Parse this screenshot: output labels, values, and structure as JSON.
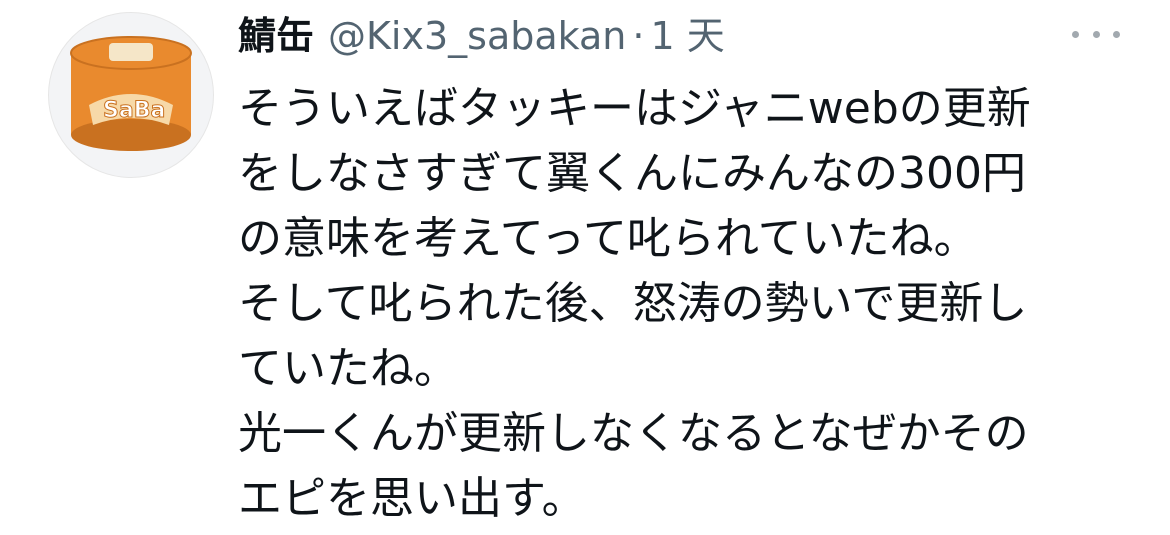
{
  "tweet": {
    "display_name": "鯖缶",
    "handle": "@Kix3_sabakan",
    "separator": "·",
    "timestamp": "1 天",
    "avatar_icon": "saba-can-icon",
    "avatar_text": "SaBa",
    "lines": [
      "そういえばタッキーはジャニwebの更新",
      "をしなさすぎて翼くんにみんなの300円",
      "の意味を考えてって叱られていたね。",
      "そして叱られた後、怒涛の勢いで更新し",
      "ていたね。",
      "光一くんが更新しなくなるとなぜかその",
      "エピを思い出す。"
    ]
  },
  "colors": {
    "text": "#0f1419",
    "secondary": "#536471",
    "can_orange": "#e98a2e"
  }
}
